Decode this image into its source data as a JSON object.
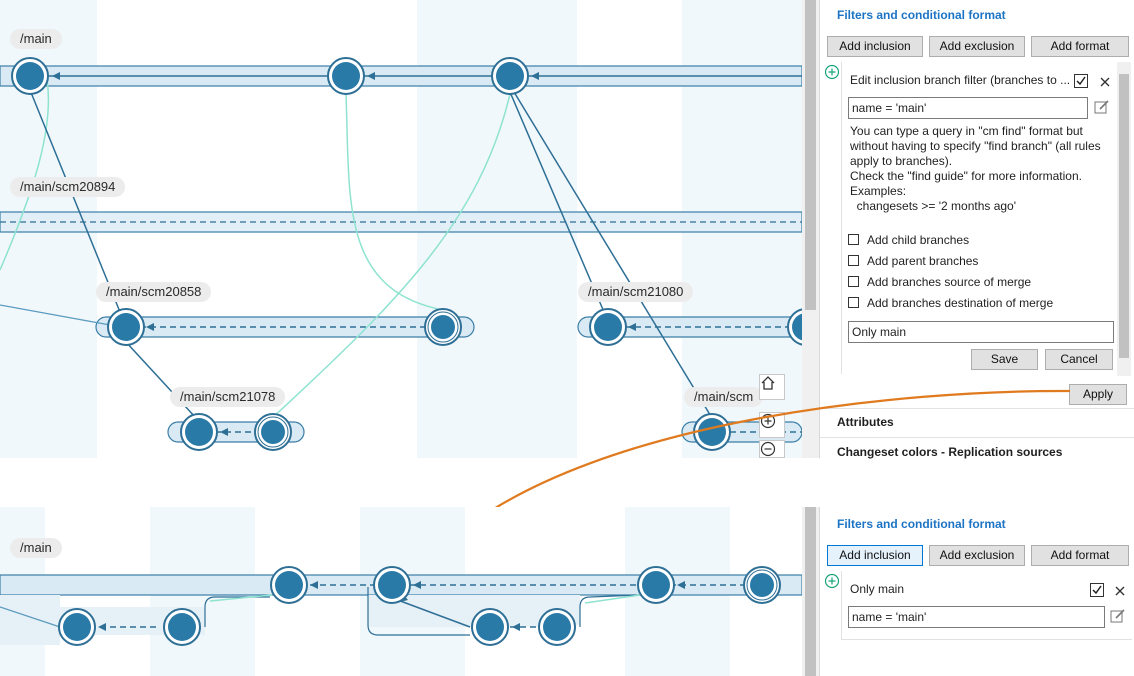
{
  "colors": {
    "node": "#2a7aa8",
    "edge": "#2e6f96",
    "merge": "#8ee3d0",
    "accent": "#1d74c4",
    "arrow": "#e07a1e"
  },
  "top": {
    "branches": {
      "main": "/main",
      "scm20894": "/main/scm20894",
      "scm20858": "/main/scm20858",
      "scm21080": "/main/scm21080",
      "scm21078": "/main/scm21078",
      "scm_partial": "/main/scm"
    },
    "panel": {
      "title": "Filters and conditional format",
      "buttons": {
        "add_inclusion": "Add inclusion",
        "add_exclusion": "Add exclusion",
        "add_format": "Add format"
      },
      "edit_header": "Edit inclusion branch filter (branches to ...",
      "query_value": "name = 'main'",
      "help_lines": [
        "You can type a query in \"cm find\" format but",
        "without having to specify \"find branch\" (all rules",
        "apply to branches).",
        "Check the \"find guide\" for more information.",
        "Examples:",
        "  changesets >= '2 months ago'"
      ],
      "checkboxes": [
        "Add child branches",
        "Add parent branches",
        "Add branches source of merge",
        "Add branches destination of merge"
      ],
      "name_value": "Only main",
      "save": "Save",
      "cancel": "Cancel",
      "apply": "Apply",
      "section_attributes": "Attributes",
      "section_colors": "Changeset colors - Replication sources"
    }
  },
  "bottom": {
    "branch_main": "/main",
    "panel": {
      "title": "Filters and conditional format",
      "buttons": {
        "add_inclusion": "Add inclusion",
        "add_exclusion": "Add exclusion",
        "add_format": "Add format"
      },
      "filter_name": "Only main",
      "query_value": "name = 'main'"
    }
  },
  "icons": {
    "add": "plus-circle-icon",
    "check": "checked-checkbox-icon",
    "close": "close-icon",
    "edit": "edit-icon",
    "home": "home-icon",
    "zoom_in": "zoom-in-icon",
    "zoom_out": "zoom-out-icon"
  }
}
